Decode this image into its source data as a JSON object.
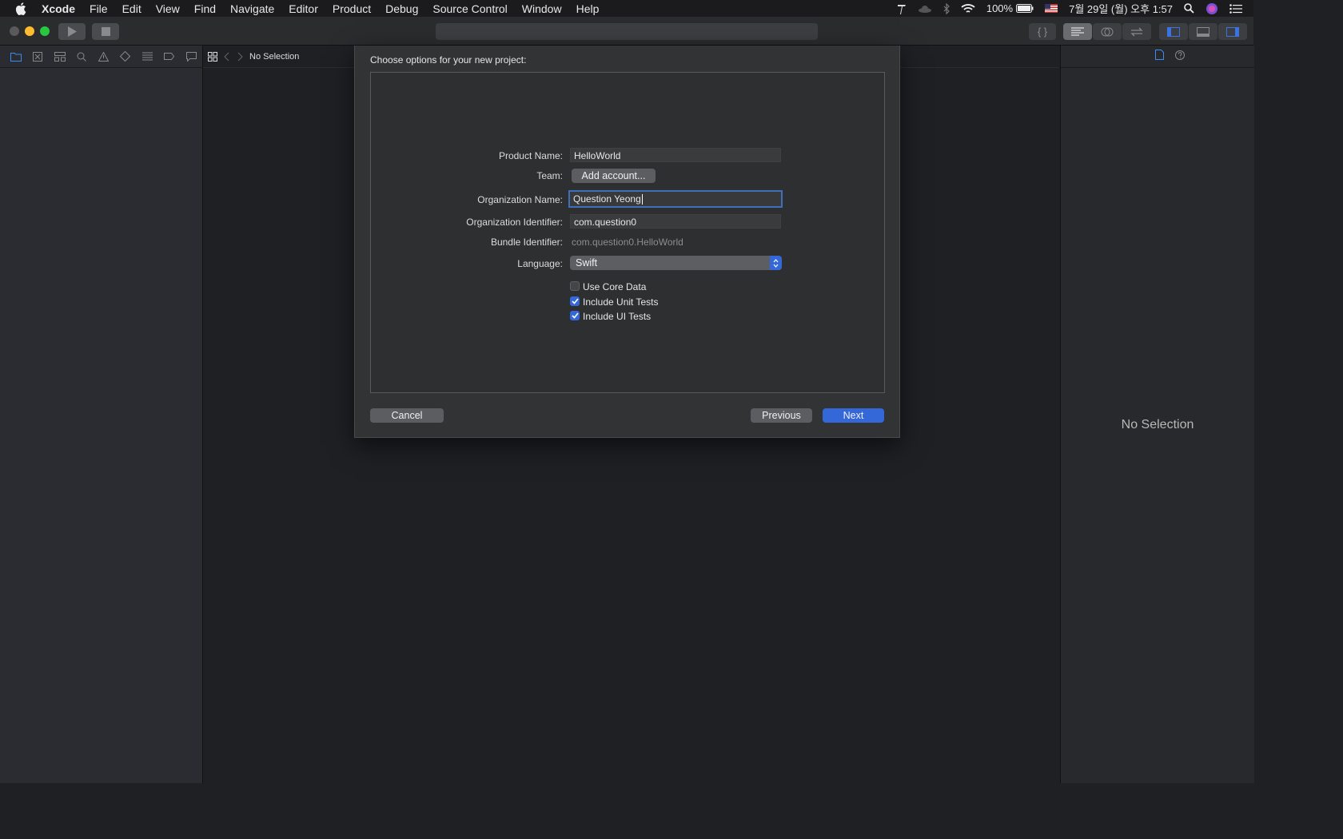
{
  "menubar": {
    "app": "Xcode",
    "items": [
      "File",
      "Edit",
      "View",
      "Find",
      "Navigate",
      "Editor",
      "Product",
      "Debug",
      "Source Control",
      "Window",
      "Help"
    ],
    "battery": "100%",
    "datetime": "7월 29일 (월) 오후 1:57"
  },
  "jumpbar": {
    "status": "No Selection"
  },
  "inspector": {
    "empty_text": "No Selection"
  },
  "sheet": {
    "title": "Choose options for your new project:",
    "product_name": {
      "label": "Product Name:",
      "value": "HelloWorld"
    },
    "team": {
      "label": "Team:",
      "button": "Add account..."
    },
    "org_name": {
      "label": "Organization Name:",
      "value": "Question Yeong"
    },
    "org_identifier": {
      "label": "Organization Identifier:",
      "value": "com.question0"
    },
    "bundle_identifier": {
      "label": "Bundle Identifier:",
      "value": "com.question0.HelloWorld"
    },
    "language": {
      "label": "Language:",
      "value": "Swift"
    },
    "checkboxes": [
      {
        "label": "Use Core Data",
        "checked": false
      },
      {
        "label": "Include Unit Tests",
        "checked": true
      },
      {
        "label": "Include UI Tests",
        "checked": true
      }
    ],
    "cancel": "Cancel",
    "previous": "Previous",
    "next": "Next"
  },
  "colors": {
    "accent": "#3468d8",
    "focus_ring": "#3f6fb8",
    "close": "#ff5f57",
    "minimize": "#febc2e",
    "zoom": "#28c840"
  }
}
